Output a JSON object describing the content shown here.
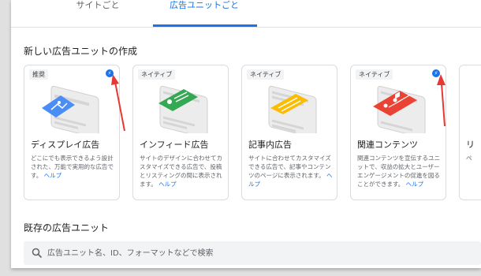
{
  "tabs": [
    {
      "label": "サイトごと"
    },
    {
      "label": "広告ユニットごと"
    }
  ],
  "create_section_title": "新しい広告ユニットの作成",
  "existing_section_title": "既存の広告ユニット",
  "cards": [
    {
      "badge": "推奨",
      "title": "ディスプレイ広告",
      "desc": "どこにでも表示できるよう設計された、万能で実用的な広告です。",
      "help": "ヘルプ",
      "has_bolt": true,
      "accent": "#4a8df6"
    },
    {
      "badge": "ネイティブ",
      "title": "インフィード広告",
      "desc": "サイトのデザインに合わせてカスタマイズできる広告で、投稿とリスティングの間に表示されます。",
      "help": "ヘルプ",
      "has_bolt": false,
      "accent": "#34a853"
    },
    {
      "badge": "ネイティブ",
      "title": "記事内広告",
      "desc": "サイトに合わせてカスタマイズできる広告で、記事やコンテンツのページに表示されます。",
      "help": "ヘルプ",
      "has_bolt": false,
      "accent": "#fbbc04"
    },
    {
      "badge": "ネイティブ",
      "title": "関連コンテンツ",
      "desc": "関連コンテンツを宣伝するユニットで、収益の拡大とユーザー エンゲージメントの促進を図ることができます。",
      "help": "ヘルプ",
      "has_bolt": true,
      "accent": "#ea4335"
    }
  ],
  "partial_card": {
    "title": "リ",
    "desc": "ペ"
  },
  "search": {
    "placeholder": "広告ユニット名、ID、フォーマットなどで検索",
    "value": ""
  },
  "colors": {
    "primary": "#1a73e8",
    "arrow": "#e53935"
  },
  "icons": {
    "bolt": "bolt-icon",
    "search": "search-icon"
  }
}
